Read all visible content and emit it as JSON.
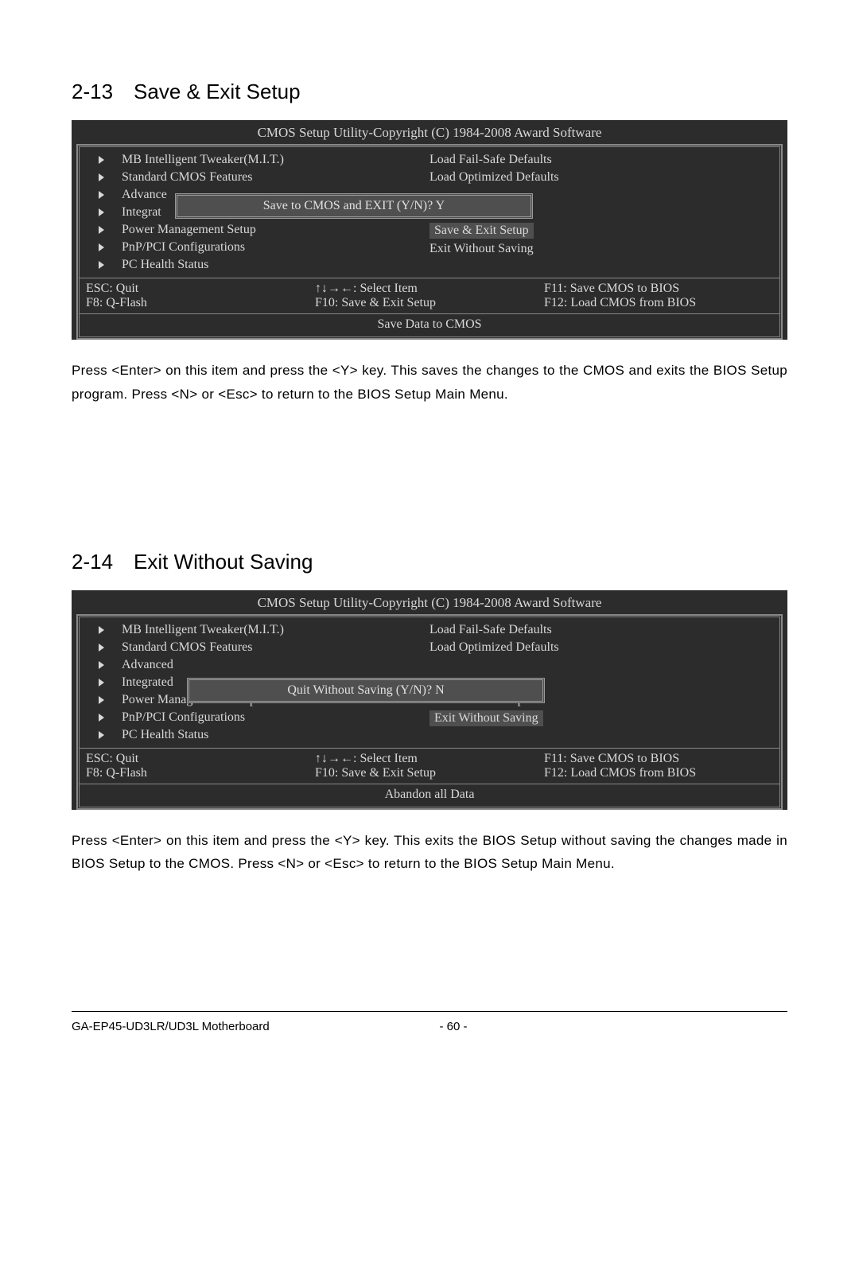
{
  "section1": {
    "heading": "2-13 Save & Exit Setup",
    "bios_title": "CMOS Setup Utility-Copyright (C) 1984-2008 Award Software",
    "left_items": [
      "MB Intelligent Tweaker(M.I.T.)",
      "Standard CMOS Features",
      "Advance",
      "Integrat",
      "Power Management Setup",
      "PnP/PCI Configurations",
      "PC Health Status"
    ],
    "right_items": [
      "Load Fail-Safe Defaults",
      "Load Optimized Defaults",
      "",
      "",
      "Save & Exit Setup",
      "Exit Without Saving"
    ],
    "highlight_index_right": 4,
    "popup_text": "Save to CMOS and EXIT (Y/N)? Y",
    "footer": {
      "esc": "ESC: Quit",
      "arrows": "↑↓→←: Select Item",
      "f11": "F11: Save CMOS to BIOS",
      "f8": "F8: Q-Flash",
      "f10": "F10: Save & Exit Setup",
      "f12": "F12: Load CMOS from BIOS"
    },
    "status": "Save Data to CMOS",
    "instruction": "Press <Enter> on this item and press the <Y> key. This saves the changes to the CMOS and exits the BIOS Setup program. Press <N> or <Esc> to return to the BIOS Setup Main Menu."
  },
  "section2": {
    "heading": "2-14 Exit Without Saving",
    "bios_title": "CMOS Setup Utility-Copyright (C) 1984-2008 Award Software",
    "left_items": [
      "MB Intelligent Tweaker(M.I.T.)",
      "Standard CMOS Features",
      "Advanced",
      "Integrated",
      "Power Management Setup",
      "PnP/PCI Configurations",
      "PC Health Status"
    ],
    "right_items": [
      "Load Fail-Safe Defaults",
      "Load Optimized Defaults",
      "",
      "",
      "Save & Exit Setup",
      "Exit Without Saving"
    ],
    "highlight_index_right": 5,
    "popup_text": "Quit Without Saving (Y/N)? N",
    "footer": {
      "esc": "ESC: Quit",
      "arrows": "↑↓→←: Select Item",
      "f11": "F11: Save CMOS to BIOS",
      "f8": "F8: Q-Flash",
      "f10": "F10: Save & Exit Setup",
      "f12": "F12: Load CMOS from BIOS"
    },
    "status": "Abandon all Data",
    "instruction": "Press <Enter> on this item and press the <Y> key. This exits the BIOS Setup without saving the changes made in BIOS Setup to the CMOS. Press <N> or <Esc> to return to the BIOS Setup Main Menu."
  },
  "footer": {
    "left": "GA-EP45-UD3LR/UD3L Motherboard",
    "center": "- 60 -"
  }
}
